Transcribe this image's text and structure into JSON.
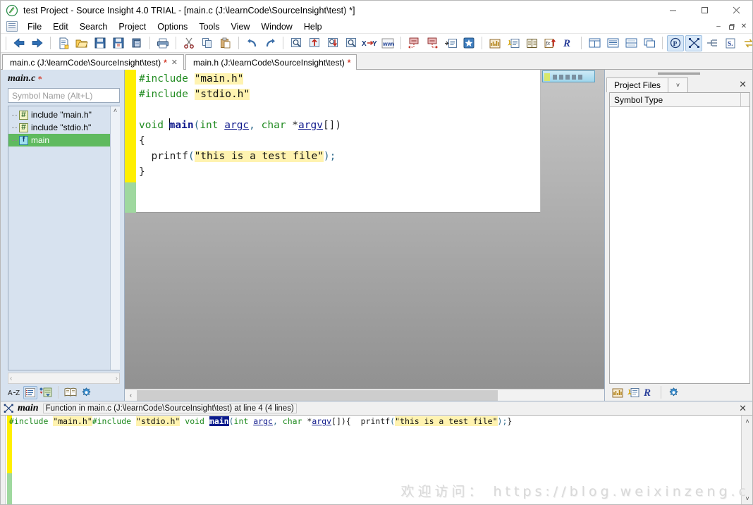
{
  "window": {
    "title": "test Project - Source Insight 4.0 TRIAL - [main.c (J:\\learnCode\\SourceInsight\\test) *]",
    "app_icon": "source-insight-icon",
    "minimize": "—",
    "maximize": "☐",
    "close": "✕"
  },
  "menu": {
    "items": [
      {
        "label": "File"
      },
      {
        "label": "Edit"
      },
      {
        "label": "Search"
      },
      {
        "label": "Project"
      },
      {
        "label": "Options"
      },
      {
        "label": "Tools"
      },
      {
        "label": "View"
      },
      {
        "label": "Window"
      },
      {
        "label": "Help"
      }
    ],
    "mdi": {
      "minimize": "–",
      "restore": "❐",
      "close": "✕"
    }
  },
  "toolbar": {
    "groups": [
      {
        "buttons": [
          {
            "name": "back-icon",
            "label": "Back"
          },
          {
            "name": "forward-icon",
            "label": "Forward"
          }
        ]
      },
      {
        "buttons": [
          {
            "name": "new-file-icon",
            "label": "New File"
          },
          {
            "name": "open-file-icon",
            "label": "Open File"
          },
          {
            "name": "save-icon",
            "label": "Save"
          },
          {
            "name": "save-all-icon",
            "label": "Save All"
          },
          {
            "name": "close-file-icon",
            "label": "Close File"
          }
        ]
      },
      {
        "buttons": [
          {
            "name": "print-icon",
            "label": "Print"
          }
        ]
      },
      {
        "buttons": [
          {
            "name": "cut-icon",
            "label": "Cut"
          },
          {
            "name": "copy-icon",
            "label": "Copy"
          },
          {
            "name": "paste-icon",
            "label": "Paste"
          }
        ]
      },
      {
        "buttons": [
          {
            "name": "undo-icon",
            "label": "Undo"
          },
          {
            "name": "redo-icon",
            "label": "Redo"
          }
        ]
      },
      {
        "buttons": [
          {
            "name": "search-icon",
            "label": "Search"
          },
          {
            "name": "search-backward-icon",
            "label": "Search Backward"
          },
          {
            "name": "search-forward-icon",
            "label": "Search Forward"
          },
          {
            "name": "lookup-references-icon",
            "label": "Lookup References"
          },
          {
            "name": "replace-icon",
            "label": "Replace"
          },
          {
            "name": "search-web-icon",
            "label": "Search Web"
          }
        ]
      },
      {
        "buttons": [
          {
            "name": "jump-back-icon",
            "label": "Jump Back"
          },
          {
            "name": "jump-forward-icon",
            "label": "Jump Forward"
          },
          {
            "name": "jump-to-definition-icon",
            "label": "Jump To Definition"
          },
          {
            "name": "bookmark-icon",
            "label": "Bookmark"
          }
        ]
      },
      {
        "buttons": [
          {
            "name": "context-window-icon",
            "label": "Context Window"
          },
          {
            "name": "symbol-window-icon",
            "label": "Symbol Window"
          },
          {
            "name": "relation-window-icon",
            "label": "Relation Window"
          },
          {
            "name": "function-list-icon",
            "label": "Function List"
          },
          {
            "name": "source-insight-r-icon",
            "label": "Source Insight"
          }
        ]
      },
      {
        "buttons": [
          {
            "name": "tile-windows-icon",
            "label": "Tile Windows"
          },
          {
            "name": "tile-horizontal-icon",
            "label": "Tile Horizontally"
          },
          {
            "name": "tile-vertical-icon",
            "label": "Tile Vertically"
          },
          {
            "name": "cascade-windows-icon",
            "label": "Cascade Windows"
          }
        ]
      },
      {
        "buttons": [
          {
            "name": "parse-icon",
            "label": "Parse",
            "active": true
          },
          {
            "name": "smart-rename-icon",
            "label": "Smart Rename",
            "active": true
          },
          {
            "name": "indent-icon",
            "label": "Indent"
          },
          {
            "name": "spelling-icon",
            "label": "Check Spelling"
          },
          {
            "name": "sync-icon",
            "label": "Synchronize Files"
          }
        ]
      }
    ]
  },
  "tabs": [
    {
      "label": "main.c (J:\\learnCode\\SourceInsight\\test)",
      "modified": "*",
      "closable": true,
      "close": "✕",
      "active": true
    },
    {
      "label": "main.h (J:\\learnCode\\SourceInsight\\test)",
      "modified": "*",
      "closable": false,
      "close": "",
      "active": false
    }
  ],
  "symbol_panel": {
    "title": "main.c",
    "modified": "*",
    "search_placeholder": "Symbol Name (Alt+L)",
    "search_value": "",
    "items": [
      {
        "icon": "hash-symbol-icon",
        "label": "include \"main.h\"",
        "selected": false
      },
      {
        "icon": "hash-symbol-icon",
        "label": "include \"stdio.h\"",
        "selected": false
      },
      {
        "icon": "function-symbol-icon",
        "label": "main",
        "selected": true
      }
    ],
    "scroll_up": "˄",
    "scroll_down": "˅",
    "hscroll_left": "‹",
    "hscroll_right": "›",
    "toolbar": [
      {
        "name": "sort-az-icon",
        "label": "A-Z"
      },
      {
        "name": "outline-view-icon",
        "label": "Outline",
        "active": true
      },
      {
        "name": "symbol-filter-icon",
        "label": "Symbol Filter"
      },
      {
        "name": "book-icon",
        "label": "Contents"
      },
      {
        "name": "gear-icon",
        "label": "Options"
      }
    ]
  },
  "editor": {
    "lines": [
      {
        "tokens": [
          {
            "t": "#include ",
            "c": "k-pp"
          },
          {
            "t": "\"main.h\"",
            "c": "k-str"
          }
        ]
      },
      {
        "tokens": [
          {
            "t": "#include ",
            "c": "k-pp"
          },
          {
            "t": "\"stdio.h\"",
            "c": "k-str"
          }
        ]
      },
      {
        "tokens": []
      },
      {
        "tokens": [
          {
            "t": "void ",
            "c": "k-kw"
          },
          {
            "t": "main",
            "c": "k-fn"
          },
          {
            "t": "(",
            "c": "k-paren"
          },
          {
            "t": "int ",
            "c": "k-kw"
          },
          {
            "t": "argc",
            "c": "k-var"
          },
          {
            "t": ", ",
            "c": "k-paren"
          },
          {
            "t": "char ",
            "c": "k-kw"
          },
          {
            "t": "*",
            "c": "k-pun"
          },
          {
            "t": "argv",
            "c": "k-var"
          },
          {
            "t": "[])",
            "c": "k-pun"
          }
        ]
      },
      {
        "tokens": [
          {
            "t": "{",
            "c": "k-pun"
          }
        ]
      },
      {
        "tokens": [
          {
            "t": "  printf",
            "c": "k-call"
          },
          {
            "t": "(",
            "c": "k-paren"
          },
          {
            "t": "\"this is a test file\"",
            "c": "k-str"
          },
          {
            "t": ");",
            "c": "k-paren"
          }
        ]
      },
      {
        "tokens": [
          {
            "t": "}",
            "c": "k-pun"
          }
        ]
      }
    ],
    "scroll_up": "˄",
    "scroll_down": "˅",
    "hscroll_left": "‹",
    "hscroll_right": "›"
  },
  "project_panel": {
    "tab_label": "Project Files",
    "dropdown": "˅",
    "close": "✕",
    "column_header": "Symbol Type",
    "rows": [],
    "toolbar": [
      {
        "name": "context-window-icon",
        "label": "Context Window"
      },
      {
        "name": "symbol-window-icon",
        "label": "Symbol Window"
      },
      {
        "name": "source-insight-r-icon",
        "label": "Relation Window"
      },
      {
        "name": "gear-icon",
        "label": "Options"
      }
    ]
  },
  "context_panel": {
    "icon": "context-window-icon",
    "symbol": "main",
    "description": "Function in main.c (J:\\learnCode\\SourceInsight\\test) at line 4 (4 lines)",
    "close": "✕",
    "lines": [
      {
        "tokens": [
          {
            "t": "#include ",
            "c": "k-pp"
          },
          {
            "t": "\"main.h\"",
            "c": "k-str"
          }
        ]
      },
      {
        "tokens": [
          {
            "t": "#include ",
            "c": "k-pp"
          },
          {
            "t": "\"stdio.h\"",
            "c": "k-str"
          }
        ]
      },
      {
        "tokens": []
      },
      {
        "tokens": [
          {
            "t": "void ",
            "c": "k-kw"
          },
          {
            "t": "main",
            "c": "k-sel"
          },
          {
            "t": "(",
            "c": "k-paren"
          },
          {
            "t": "int ",
            "c": "k-kw"
          },
          {
            "t": "argc",
            "c": "k-var"
          },
          {
            "t": ", ",
            "c": "k-paren"
          },
          {
            "t": "char ",
            "c": "k-kw"
          },
          {
            "t": "*",
            "c": "k-pun"
          },
          {
            "t": "argv",
            "c": "k-var"
          },
          {
            "t": "[])",
            "c": "k-pun"
          }
        ]
      },
      {
        "tokens": [
          {
            "t": "{",
            "c": "k-pun"
          }
        ]
      },
      {
        "tokens": [
          {
            "t": "  printf",
            "c": "k-call"
          },
          {
            "t": "(",
            "c": "k-paren"
          },
          {
            "t": "\"this is a test file\"",
            "c": "k-str"
          },
          {
            "t": ");",
            "c": "k-paren"
          }
        ]
      },
      {
        "tokens": [
          {
            "t": "}",
            "c": "k-pun"
          }
        ]
      }
    ],
    "scroll_up": "˄",
    "scroll_down": "˅"
  },
  "watermark": "欢迎访问： https://blog.weixinzeng.c",
  "colors": {
    "accent": "#3a6ea5",
    "selection_green": "#5fba5f",
    "selection_blue": "#0a1a8c",
    "change_yellow": "#ffef00",
    "change_green": "#9fd89f",
    "string_highlight": "#fff3b0",
    "keyword_green": "#1f8a1f",
    "panel_blue": "#d7e2ef"
  }
}
